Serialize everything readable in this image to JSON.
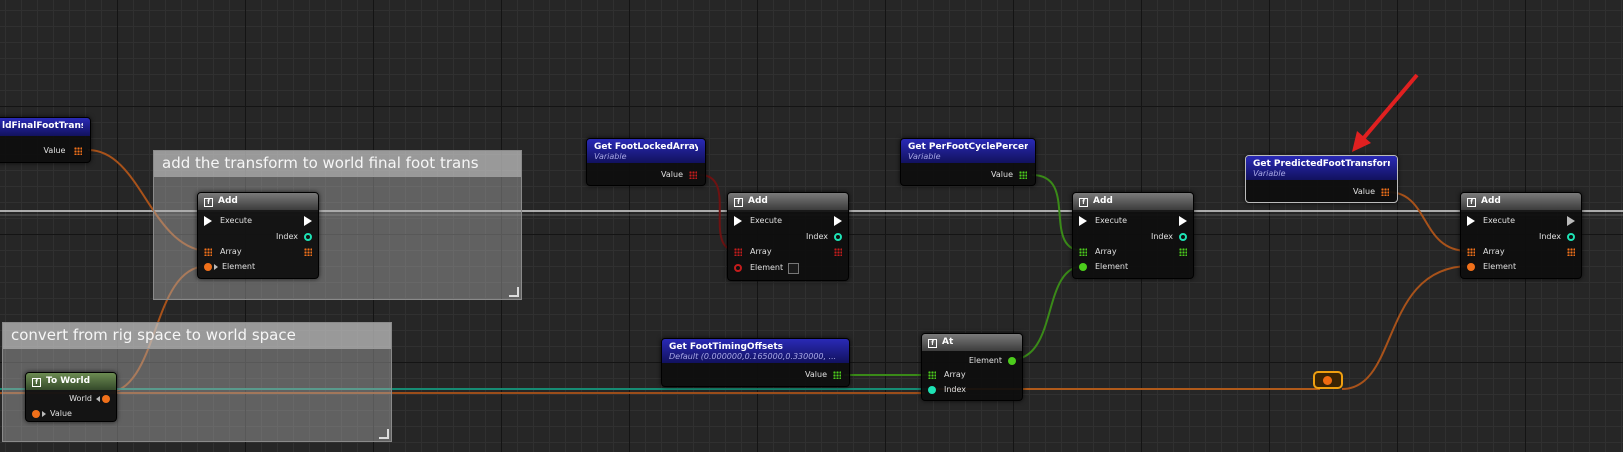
{
  "comments": {
    "add_transform": "add the transform to world final foot trans",
    "convert": "convert from rig space to world space"
  },
  "variables": {
    "final_trans": {
      "name": "ldFinalFootTrans",
      "value_label": "Value"
    },
    "foot_locked": {
      "name": "Get FootLockedArray",
      "subtitle": "Variable",
      "value_label": "Value"
    },
    "per_foot": {
      "name": "Get PerFootCyclePercent",
      "subtitle": "Variable",
      "value_label": "Value"
    },
    "predicted": {
      "name": "Get PredictedFootTransforms",
      "subtitle": "Variable",
      "value_label": "Value"
    },
    "timing": {
      "name": "Get FootTimingOffsets",
      "subtitle": "Default (0.000000,0.165000,0.330000, ...",
      "value_label": "Value"
    }
  },
  "nodes": {
    "add": {
      "title": "Add",
      "execute": "Execute",
      "index": "Index",
      "array": "Array",
      "element": "Element"
    },
    "to_world": {
      "title": "To World",
      "world": "World",
      "value": "Value"
    },
    "at": {
      "title": "At",
      "element": "Element",
      "array": "Array",
      "index": "Index"
    }
  },
  "colors": {
    "transform": "#f0701a",
    "bool": "#8a1616",
    "float": "#4ccc1c",
    "int": "#1ee3b5",
    "exec": "#ffffff",
    "variable_header": "#1c1c8e",
    "reroute_highlight": "#f0a010",
    "annotation_arrow": "#e02020"
  },
  "icons": {
    "function": "function-icon",
    "annotation": "red-arrow-annotation"
  }
}
